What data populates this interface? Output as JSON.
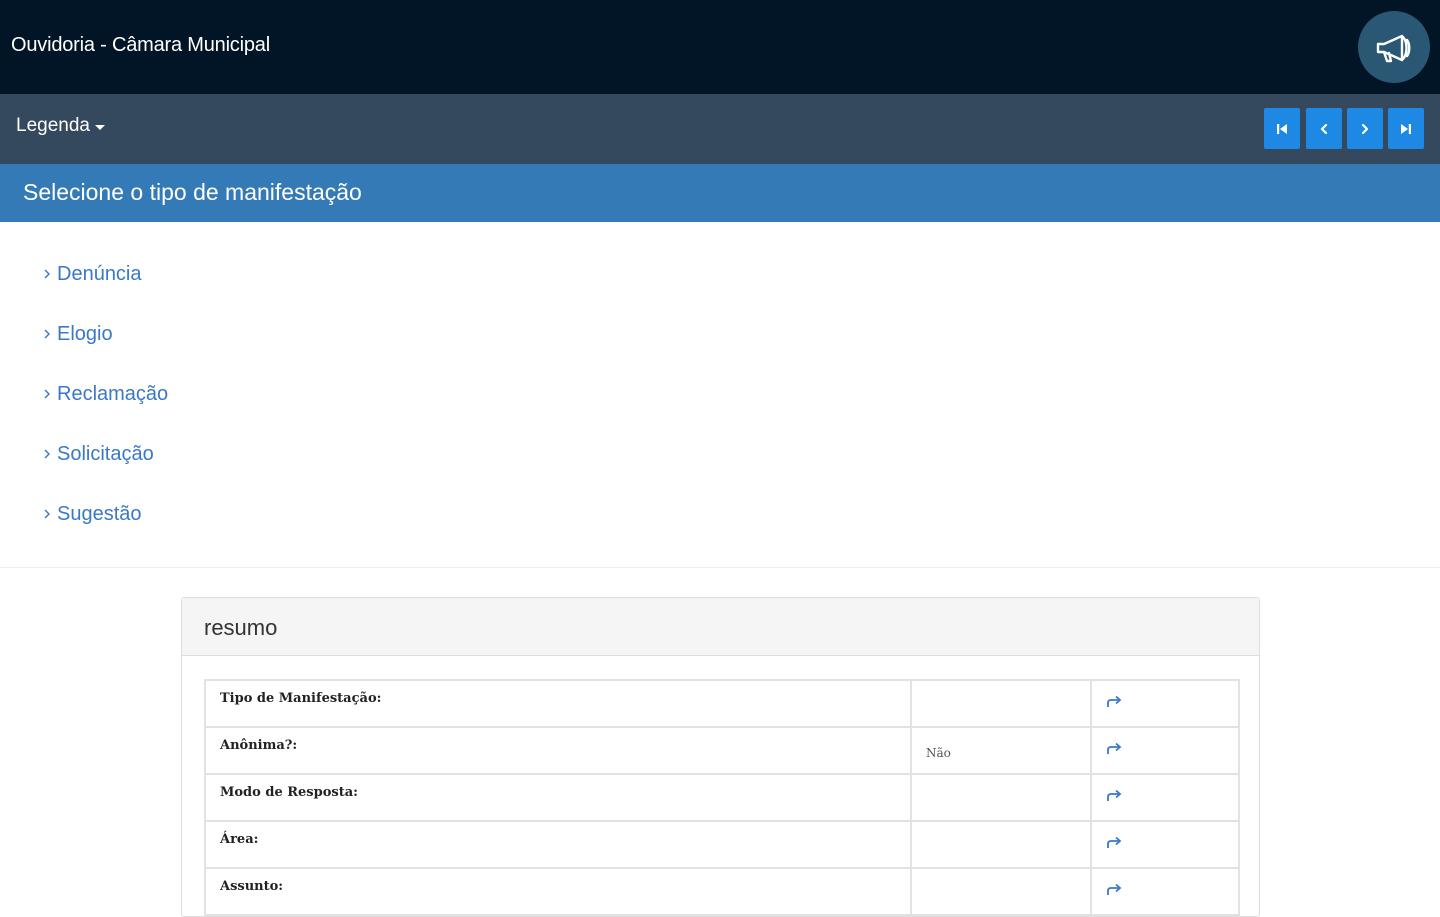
{
  "header": {
    "title": "Ouvidoria - Câmara Municipal",
    "action_icon": "megaphone-icon",
    "background": "#021526"
  },
  "toolbar": {
    "legend_label": "Legenda",
    "nav_buttons": [
      {
        "name": "first",
        "icon": "step-backward-icon"
      },
      {
        "name": "previous",
        "icon": "chevron-left-icon"
      },
      {
        "name": "next",
        "icon": "chevron-right-icon"
      },
      {
        "name": "last",
        "icon": "step-forward-icon"
      }
    ],
    "accent": "#1e88e5"
  },
  "section": {
    "title": "Selecione o tipo de manifestação",
    "accent": "#337ab7"
  },
  "manifestation_types": [
    {
      "label": "Denúncia"
    },
    {
      "label": "Elogio"
    },
    {
      "label": "Reclamação"
    },
    {
      "label": "Solicitação"
    },
    {
      "label": "Sugestão"
    }
  ],
  "summary": {
    "title": "resumo",
    "rows": [
      {
        "label": "Tipo de Manifestação:",
        "value": "",
        "action_icon": "share-arrow-icon"
      },
      {
        "label": "Anônima?:",
        "value": "Não",
        "action_icon": "share-arrow-icon"
      },
      {
        "label": "Modo de Resposta:",
        "value": "",
        "action_icon": "share-arrow-icon"
      },
      {
        "label": "Área:",
        "value": "",
        "action_icon": "share-arrow-icon"
      },
      {
        "label": "Assunto:",
        "value": "",
        "action_icon": "share-arrow-icon"
      }
    ]
  }
}
